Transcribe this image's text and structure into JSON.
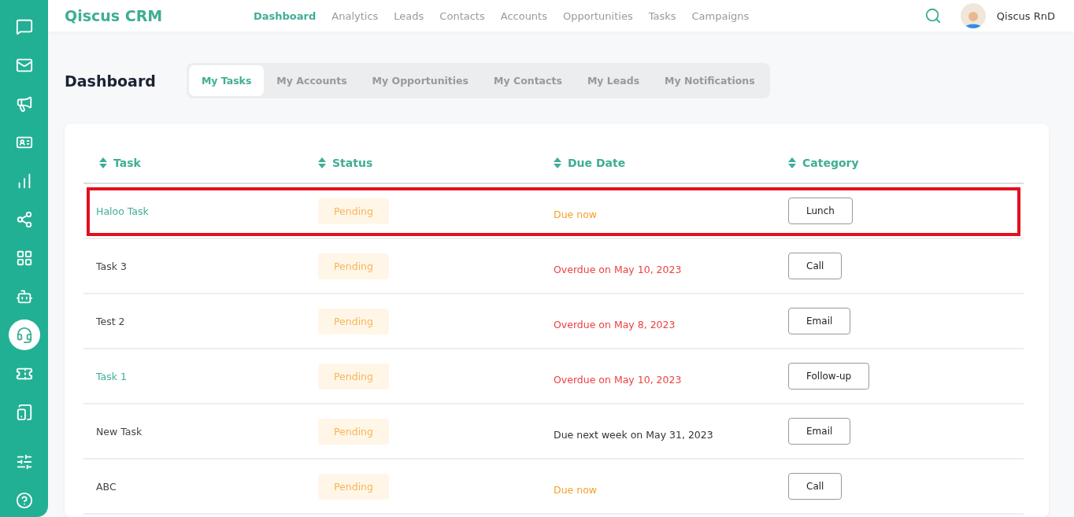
{
  "sidebar": {
    "items": [
      {
        "selected": false
      },
      {
        "selected": false
      },
      {
        "selected": false
      },
      {
        "selected": false
      },
      {
        "selected": false
      },
      {
        "selected": false
      },
      {
        "selected": false
      },
      {
        "selected": false
      },
      {
        "selected": true
      },
      {
        "selected": false
      },
      {
        "selected": false
      },
      {
        "selected": false
      },
      {
        "selected": false
      }
    ]
  },
  "header": {
    "brand": "Qiscus CRM",
    "nav": [
      {
        "label": "Dashboard",
        "selected": true
      },
      {
        "label": "Analytics",
        "selected": false
      },
      {
        "label": "Leads",
        "selected": false
      },
      {
        "label": "Contacts",
        "selected": false
      },
      {
        "label": "Accounts",
        "selected": false
      },
      {
        "label": "Opportunities",
        "selected": false
      },
      {
        "label": "Tasks",
        "selected": false
      },
      {
        "label": "Campaigns",
        "selected": false
      }
    ],
    "user": "Qiscus RnD"
  },
  "page": {
    "title": "Dashboard",
    "tabs": [
      {
        "label": "My Tasks",
        "selected": true
      },
      {
        "label": "My Accounts",
        "selected": false
      },
      {
        "label": "My Opportunities",
        "selected": false
      },
      {
        "label": "My Contacts",
        "selected": false
      },
      {
        "label": "My Leads",
        "selected": false
      },
      {
        "label": "My Notifications",
        "selected": false
      }
    ]
  },
  "table": {
    "columns": [
      "Task",
      "Status",
      "Due Date",
      "Category"
    ],
    "rows": [
      {
        "task": "Haloo Task",
        "linked": true,
        "highlighted": true,
        "status": "Pending",
        "due": "Due now",
        "kind": "now",
        "category": "Lunch"
      },
      {
        "task": "Task 3",
        "linked": false,
        "highlighted": false,
        "status": "Pending",
        "due": "Overdue on May 10, 2023",
        "kind": "overdue",
        "category": "Call"
      },
      {
        "task": "Test 2",
        "linked": false,
        "highlighted": false,
        "status": "Pending",
        "due": "Overdue on May 8, 2023",
        "kind": "overdue",
        "category": "Email"
      },
      {
        "task": "Task 1",
        "linked": true,
        "highlighted": false,
        "status": "Pending",
        "due": "Overdue on May 10, 2023",
        "kind": "overdue",
        "category": "Follow-up"
      },
      {
        "task": "New Task",
        "linked": false,
        "highlighted": false,
        "status": "Pending",
        "due": "Due next week on May 31, 2023",
        "kind": "later",
        "category": "Email"
      },
      {
        "task": "ABC",
        "linked": false,
        "highlighted": false,
        "status": "Pending",
        "due": "Due now",
        "kind": "now",
        "category": "Call"
      }
    ]
  }
}
